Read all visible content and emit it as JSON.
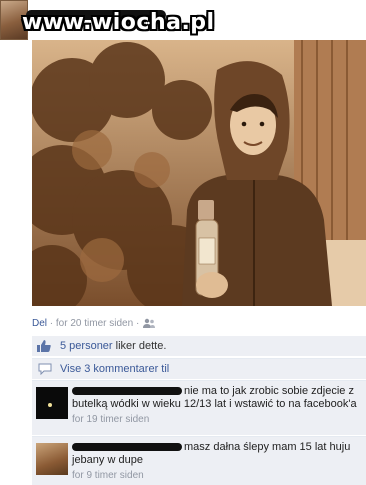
{
  "watermark": "www.wiocha.pl",
  "post": {
    "meta_delete": "Del",
    "meta_time": "· for 20 timer siden ·"
  },
  "likes": {
    "count_label": "5 personer",
    "suffix": " liker dette."
  },
  "view_comments": "Vise 3 kommentarer til",
  "comments": [
    {
      "text": "nie ma to jak zrobic sobie zdjecie z butelką wódki w wieku 12/13 lat i wstawić to na facebook'a",
      "time": "for 19 timer siden"
    },
    {
      "text": "masz dałna ślepy mam 15 lat huju jebany w dupe",
      "time": "for 9 timer siden"
    }
  ],
  "colors": {
    "link": "#3b5998",
    "meta": "#9197a3",
    "comment_bg": "#edeff4",
    "photo_tint": "#8a5a34"
  },
  "icons": {
    "like": "thumb-up-icon",
    "comments": "speech-bubble-icon",
    "audience": "friends-icon"
  }
}
